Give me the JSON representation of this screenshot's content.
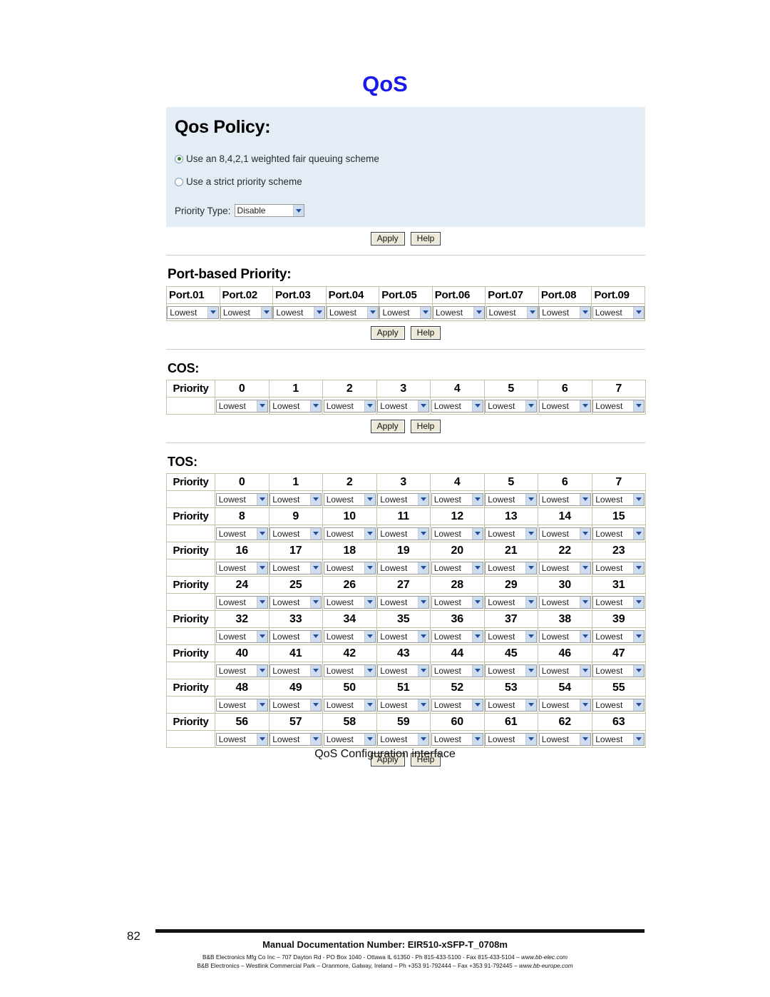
{
  "page": {
    "title": "QoS",
    "caption": "QoS Configuration interface",
    "number": "82"
  },
  "policy": {
    "heading": "Qos Policy:",
    "options": [
      {
        "label": "Use an 8,4,2,1 weighted fair queuing scheme",
        "selected": true
      },
      {
        "label": "Use a strict priority scheme",
        "selected": false
      }
    ],
    "priority_type_label": "Priority Type:",
    "priority_type_value": "Disable",
    "apply_label": "Apply",
    "help_label": "Help"
  },
  "port_based": {
    "heading": "Port-based Priority:",
    "ports": [
      "Port.01",
      "Port.02",
      "Port.03",
      "Port.04",
      "Port.05",
      "Port.06",
      "Port.07",
      "Port.08",
      "Port.09"
    ],
    "values": [
      "Lowest",
      "Lowest",
      "Lowest",
      "Lowest",
      "Lowest",
      "Lowest",
      "Lowest",
      "Lowest",
      "Lowest"
    ],
    "apply_label": "Apply",
    "help_label": "Help"
  },
  "cos": {
    "heading": "COS:",
    "priority_label": "Priority",
    "priorities": [
      "0",
      "1",
      "2",
      "3",
      "4",
      "5",
      "6",
      "7"
    ],
    "values": [
      "Lowest",
      "Lowest",
      "Lowest",
      "Lowest",
      "Lowest",
      "Lowest",
      "Lowest",
      "Lowest"
    ],
    "apply_label": "Apply",
    "help_label": "Help"
  },
  "tos": {
    "heading": "TOS:",
    "priority_label": "Priority",
    "rows": [
      {
        "priorities": [
          "0",
          "1",
          "2",
          "3",
          "4",
          "5",
          "6",
          "7"
        ],
        "values": [
          "Lowest",
          "Lowest",
          "Lowest",
          "Lowest",
          "Lowest",
          "Lowest",
          "Lowest",
          "Lowest"
        ]
      },
      {
        "priorities": [
          "8",
          "9",
          "10",
          "11",
          "12",
          "13",
          "14",
          "15"
        ],
        "values": [
          "Lowest",
          "Lowest",
          "Lowest",
          "Lowest",
          "Lowest",
          "Lowest",
          "Lowest",
          "Lowest"
        ]
      },
      {
        "priorities": [
          "16",
          "17",
          "18",
          "19",
          "20",
          "21",
          "22",
          "23"
        ],
        "values": [
          "Lowest",
          "Lowest",
          "Lowest",
          "Lowest",
          "Lowest",
          "Lowest",
          "Lowest",
          "Lowest"
        ]
      },
      {
        "priorities": [
          "24",
          "25",
          "26",
          "27",
          "28",
          "29",
          "30",
          "31"
        ],
        "values": [
          "Lowest",
          "Lowest",
          "Lowest",
          "Lowest",
          "Lowest",
          "Lowest",
          "Lowest",
          "Lowest"
        ]
      },
      {
        "priorities": [
          "32",
          "33",
          "34",
          "35",
          "36",
          "37",
          "38",
          "39"
        ],
        "values": [
          "Lowest",
          "Lowest",
          "Lowest",
          "Lowest",
          "Lowest",
          "Lowest",
          "Lowest",
          "Lowest"
        ]
      },
      {
        "priorities": [
          "40",
          "41",
          "42",
          "43",
          "44",
          "45",
          "46",
          "47"
        ],
        "values": [
          "Lowest",
          "Lowest",
          "Lowest",
          "Lowest",
          "Lowest",
          "Lowest",
          "Lowest",
          "Lowest"
        ]
      },
      {
        "priorities": [
          "48",
          "49",
          "50",
          "51",
          "52",
          "53",
          "54",
          "55"
        ],
        "values": [
          "Lowest",
          "Lowest",
          "Lowest",
          "Lowest",
          "Lowest",
          "Lowest",
          "Lowest",
          "Lowest"
        ]
      },
      {
        "priorities": [
          "56",
          "57",
          "58",
          "59",
          "60",
          "61",
          "62",
          "63"
        ],
        "values": [
          "Lowest",
          "Lowest",
          "Lowest",
          "Lowest",
          "Lowest",
          "Lowest",
          "Lowest",
          "Lowest"
        ]
      }
    ],
    "apply_label": "Apply",
    "help_label": "Help"
  },
  "footer": {
    "doc_number": "Manual Documentation Number: EIR510-xSFP-T_0708m",
    "address_line1_pre": "B&B Electronics Mfg Co Inc – 707 Dayton Rd - PO Box 1040 - Ottawa IL 61350 - Ph 815-433-5100 - Fax 815-433-5104 – ",
    "address_line1_url": "www.bb-elec.com",
    "address_line2_pre": "B&B Electronics – Westlink Commercial Park – Oranmore, Galway, Ireland – Ph +353 91-792444 – Fax +353 91-792445 – ",
    "address_line2_url": "www.bb-europe.com"
  },
  "colors": {
    "title_blue": "#1a1ae8",
    "panel_bg": "#e4ecf5",
    "grid_border": "#c3c3a2",
    "button_bg": "#ece9d8",
    "select_arrow_bg": "#cddcef",
    "radio_dot": "#2c7a2c"
  }
}
